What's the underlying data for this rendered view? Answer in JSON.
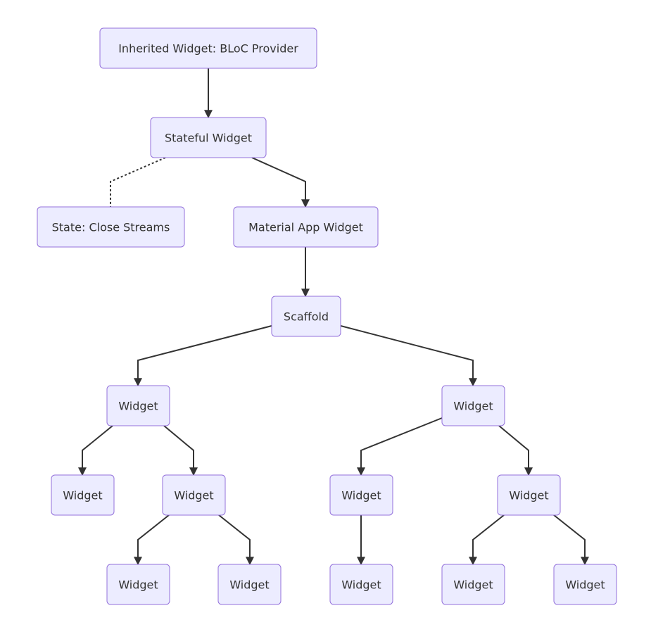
{
  "colors": {
    "node_fill": "#ECECFF",
    "node_stroke": "#9370DB",
    "edge": "#333333"
  },
  "nodes": [
    {
      "id": "provider",
      "label": "Inherited Widget: BLoC Provider"
    },
    {
      "id": "stateful",
      "label": "Stateful Widget"
    },
    {
      "id": "state",
      "label": "State: Close Streams"
    },
    {
      "id": "material",
      "label": "Material App Widget"
    },
    {
      "id": "scaffold",
      "label": "Scaffold"
    },
    {
      "id": "w1",
      "label": "Widget"
    },
    {
      "id": "w2",
      "label": "Widget"
    },
    {
      "id": "w3",
      "label": "Widget"
    },
    {
      "id": "w4",
      "label": "Widget"
    },
    {
      "id": "w5",
      "label": "Widget"
    },
    {
      "id": "w6",
      "label": "Widget"
    },
    {
      "id": "w7",
      "label": "Widget"
    },
    {
      "id": "w8",
      "label": "Widget"
    },
    {
      "id": "w9",
      "label": "Widget"
    },
    {
      "id": "w10",
      "label": "Widget"
    },
    {
      "id": "w11",
      "label": "Widget"
    }
  ],
  "edges": [
    {
      "from": "provider",
      "to": "stateful",
      "style": "solid-arrow"
    },
    {
      "from": "stateful",
      "to": "state",
      "style": "dotted"
    },
    {
      "from": "stateful",
      "to": "material",
      "style": "solid-arrow"
    },
    {
      "from": "material",
      "to": "scaffold",
      "style": "solid-arrow"
    },
    {
      "from": "scaffold",
      "to": "w1",
      "style": "solid-arrow"
    },
    {
      "from": "scaffold",
      "to": "w2",
      "style": "solid-arrow"
    },
    {
      "from": "w1",
      "to": "w3",
      "style": "solid-arrow"
    },
    {
      "from": "w1",
      "to": "w4",
      "style": "solid-arrow"
    },
    {
      "from": "w2",
      "to": "w5",
      "style": "solid-arrow"
    },
    {
      "from": "w2",
      "to": "w6",
      "style": "solid-arrow"
    },
    {
      "from": "w4",
      "to": "w7",
      "style": "solid-arrow"
    },
    {
      "from": "w4",
      "to": "w8",
      "style": "solid-arrow"
    },
    {
      "from": "w5",
      "to": "w9",
      "style": "solid-arrow"
    },
    {
      "from": "w6",
      "to": "w10",
      "style": "solid-arrow"
    },
    {
      "from": "w6",
      "to": "w11",
      "style": "solid-arrow"
    }
  ]
}
